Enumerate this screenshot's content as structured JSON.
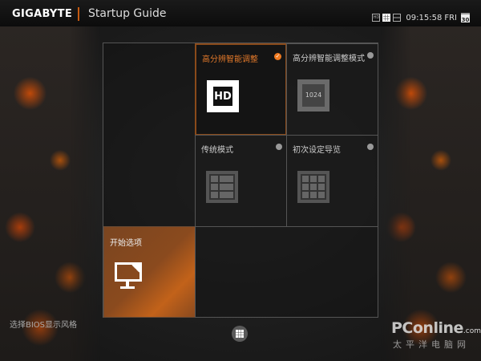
{
  "header": {
    "logo": "GIGABYTE",
    "title": "Startup Guide",
    "time": "09:15:58",
    "day": "FRI",
    "date": "30"
  },
  "tiles": [
    {
      "label": "高分辨智能调整",
      "icon_text": "HD",
      "selected": true
    },
    {
      "label": "高分辨智能调整模式",
      "icon_text": "1024",
      "selected": false
    },
    {
      "label": "传统模式",
      "selected": false
    },
    {
      "label": "初次设定导览",
      "selected": false
    },
    {
      "label": "开始选项",
      "selected": false
    }
  ],
  "footer": {
    "bios_style_label": "选择BIOS显示风格"
  },
  "watermark": {
    "brand": "PConline",
    "domain": ".com.cn",
    "subtitle": "太平洋电脑网"
  },
  "colors": {
    "accent": "#e0782a",
    "start_tile": "#8a4a1e"
  }
}
